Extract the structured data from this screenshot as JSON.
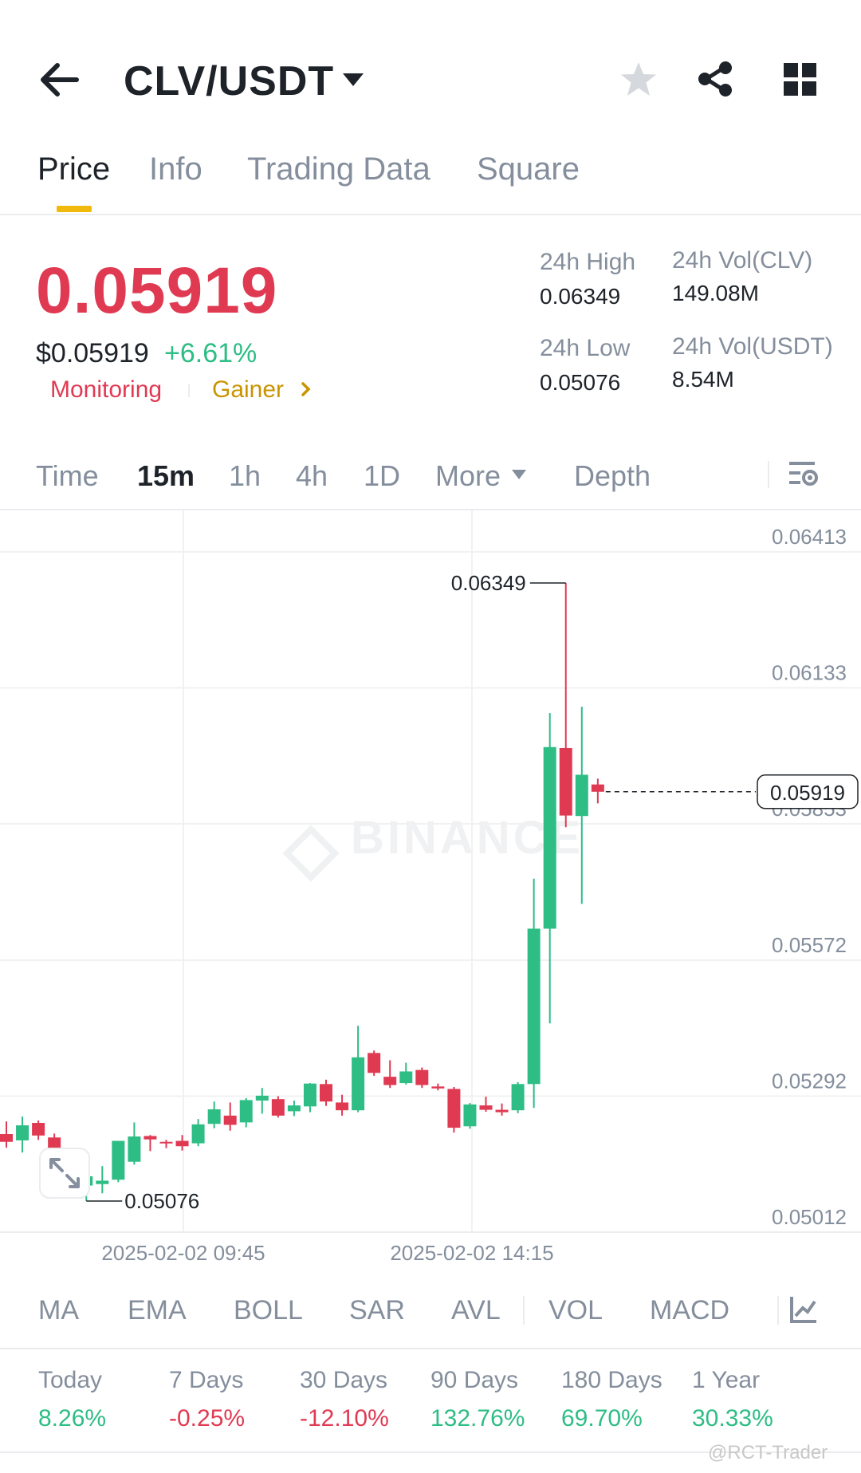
{
  "header": {
    "pair": "CLV/USDT"
  },
  "tabs": [
    {
      "label": "Price",
      "active": true
    },
    {
      "label": "Info",
      "active": false
    },
    {
      "label": "Trading Data",
      "active": false
    },
    {
      "label": "Square",
      "active": false
    }
  ],
  "ticker": {
    "price": "0.05919",
    "usd_price": "$0.05919",
    "change": "+6.61%",
    "tag_monitoring": "Monitoring",
    "tag_gainer": "Gainer",
    "high_label": "24h High",
    "high_value": "0.06349",
    "low_label": "24h Low",
    "low_value": "0.05076",
    "vol_base_label": "24h Vol(CLV)",
    "vol_base_value": "149.08M",
    "vol_quote_label": "24h Vol(USDT)",
    "vol_quote_value": "8.54M"
  },
  "timeframes": {
    "time": "Time",
    "m15": "15m",
    "h1": "1h",
    "h4": "4h",
    "d1": "1D",
    "more": "More",
    "depth": "Depth"
  },
  "colors": {
    "up": "#2ebd85",
    "down": "#e03a53",
    "accent": "#f0b90b",
    "muted": "#848e9c"
  },
  "chart_data": {
    "type": "candlestick",
    "y_ticks": [
      "0.06413",
      "0.06133",
      "0.05853",
      "0.05572",
      "0.05292",
      "0.05012"
    ],
    "x_ticks": [
      "2025-02-02 09:45",
      "2025-02-02 14:15"
    ],
    "ylim": [
      0.05012,
      0.06413
    ],
    "high_annotation": "0.06349",
    "low_annotation": "0.05076",
    "last_price": "0.05919",
    "watermark": "BINANCE",
    "candles": [
      {
        "o": 0.05214,
        "h": 0.0524,
        "l": 0.05186,
        "c": 0.05198
      },
      {
        "o": 0.05201,
        "h": 0.0525,
        "l": 0.05176,
        "c": 0.05232
      },
      {
        "o": 0.05237,
        "h": 0.05242,
        "l": 0.05202,
        "c": 0.05211
      },
      {
        "o": 0.05207,
        "h": 0.05215,
        "l": 0.05167,
        "c": 0.05179
      },
      {
        "o": 0.05155,
        "h": 0.05173,
        "l": 0.05094,
        "c": 0.05098
      },
      {
        "o": 0.05108,
        "h": 0.05152,
        "l": 0.05076,
        "c": 0.05127
      },
      {
        "o": 0.05111,
        "h": 0.05148,
        "l": 0.05092,
        "c": 0.05118
      },
      {
        "o": 0.0512,
        "h": 0.05161,
        "l": 0.05115,
        "c": 0.052
      },
      {
        "o": 0.05157,
        "h": 0.05238,
        "l": 0.05151,
        "c": 0.05209
      },
      {
        "o": 0.0521,
        "h": 0.05212,
        "l": 0.05179,
        "c": 0.05203
      },
      {
        "o": 0.05198,
        "h": 0.05202,
        "l": 0.05185,
        "c": 0.05196
      },
      {
        "o": 0.052,
        "h": 0.05212,
        "l": 0.0518,
        "c": 0.05189
      },
      {
        "o": 0.05195,
        "h": 0.05245,
        "l": 0.05189,
        "c": 0.05234
      },
      {
        "o": 0.05235,
        "h": 0.05281,
        "l": 0.05226,
        "c": 0.05265
      },
      {
        "o": 0.05252,
        "h": 0.05279,
        "l": 0.05221,
        "c": 0.05233
      },
      {
        "o": 0.05238,
        "h": 0.05288,
        "l": 0.05228,
        "c": 0.05284
      },
      {
        "o": 0.05283,
        "h": 0.05309,
        "l": 0.05256,
        "c": 0.05293
      },
      {
        "o": 0.05286,
        "h": 0.05292,
        "l": 0.05248,
        "c": 0.05252
      },
      {
        "o": 0.05261,
        "h": 0.05283,
        "l": 0.05251,
        "c": 0.05273
      },
      {
        "o": 0.05271,
        "h": 0.05319,
        "l": 0.05259,
        "c": 0.05318
      },
      {
        "o": 0.05317,
        "h": 0.05326,
        "l": 0.05272,
        "c": 0.05281
      },
      {
        "o": 0.05279,
        "h": 0.05295,
        "l": 0.05252,
        "c": 0.05263
      },
      {
        "o": 0.05263,
        "h": 0.05437,
        "l": 0.05259,
        "c": 0.05372
      },
      {
        "o": 0.05381,
        "h": 0.05386,
        "l": 0.05334,
        "c": 0.0534
      },
      {
        "o": 0.05332,
        "h": 0.05366,
        "l": 0.05309,
        "c": 0.05315
      },
      {
        "o": 0.05319,
        "h": 0.05361,
        "l": 0.05316,
        "c": 0.05343
      },
      {
        "o": 0.05346,
        "h": 0.05351,
        "l": 0.05309,
        "c": 0.05315
      },
      {
        "o": 0.05312,
        "h": 0.05318,
        "l": 0.05304,
        "c": 0.05308
      },
      {
        "o": 0.05307,
        "h": 0.05311,
        "l": 0.05217,
        "c": 0.05227
      },
      {
        "o": 0.0523,
        "h": 0.05278,
        "l": 0.05225,
        "c": 0.05275
      },
      {
        "o": 0.05273,
        "h": 0.05291,
        "l": 0.0526,
        "c": 0.05264
      },
      {
        "o": 0.05264,
        "h": 0.05277,
        "l": 0.05252,
        "c": 0.05259
      },
      {
        "o": 0.05263,
        "h": 0.05321,
        "l": 0.05257,
        "c": 0.05317
      },
      {
        "o": 0.05317,
        "h": 0.0574,
        "l": 0.05268,
        "c": 0.05637
      },
      {
        "o": 0.05637,
        "h": 0.06081,
        "l": 0.05442,
        "c": 0.06011
      },
      {
        "o": 0.06009,
        "h": 0.06349,
        "l": 0.05846,
        "c": 0.0587
      },
      {
        "o": 0.05869,
        "h": 0.06094,
        "l": 0.05688,
        "c": 0.05954
      },
      {
        "o": 0.05934,
        "h": 0.05946,
        "l": 0.05895,
        "c": 0.05919
      }
    ]
  },
  "indicators": [
    "MA",
    "EMA",
    "BOLL",
    "SAR",
    "AVL",
    "VOL",
    "MACD"
  ],
  "performance": [
    {
      "label": "Today",
      "value": "8.26%",
      "dir": "up"
    },
    {
      "label": "7 Days",
      "value": "-0.25%",
      "dir": "down"
    },
    {
      "label": "30 Days",
      "value": "-12.10%",
      "dir": "down"
    },
    {
      "label": "90 Days",
      "value": "132.76%",
      "dir": "up"
    },
    {
      "label": "180 Days",
      "value": "69.70%",
      "dir": "up"
    },
    {
      "label": "1 Year",
      "value": "30.33%",
      "dir": "up"
    }
  ],
  "watermark_user": "@RCT-Trader"
}
